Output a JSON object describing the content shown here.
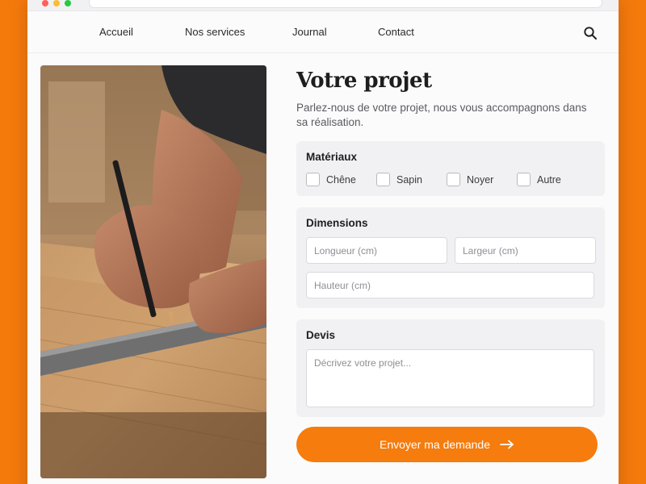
{
  "nav": {
    "items": [
      {
        "label": "Accueil"
      },
      {
        "label": "Nos services"
      },
      {
        "label": "Journal"
      },
      {
        "label": "Contact"
      }
    ],
    "search_icon": "search-icon"
  },
  "hero_image": {
    "alt": "Artisan traçant une ligne au crayon sur une planche de bois avec une équerre"
  },
  "form": {
    "title": "Votre projet",
    "subtitle": "Parlez-nous de votre projet, nous vous accompagnons dans sa réalisation.",
    "materials": {
      "title": "Matériaux",
      "options": [
        {
          "label": "Chêne",
          "checked": false
        },
        {
          "label": "Sapin",
          "checked": false
        },
        {
          "label": "Noyer",
          "checked": false
        },
        {
          "label": "Autre",
          "checked": false
        }
      ]
    },
    "dimensions": {
      "title": "Dimensions",
      "length_placeholder": "Longueur (cm)",
      "width_placeholder": "Largeur (cm)",
      "height_placeholder": "Hauteur (cm)"
    },
    "quote": {
      "title": "Devis",
      "placeholder": "Décrivez votre projet..."
    },
    "submit_label": "Envoyer ma demande",
    "submit_icon": "arrow-right-icon"
  },
  "colors": {
    "accent": "#f57c0d",
    "background": "#f57a0c"
  }
}
